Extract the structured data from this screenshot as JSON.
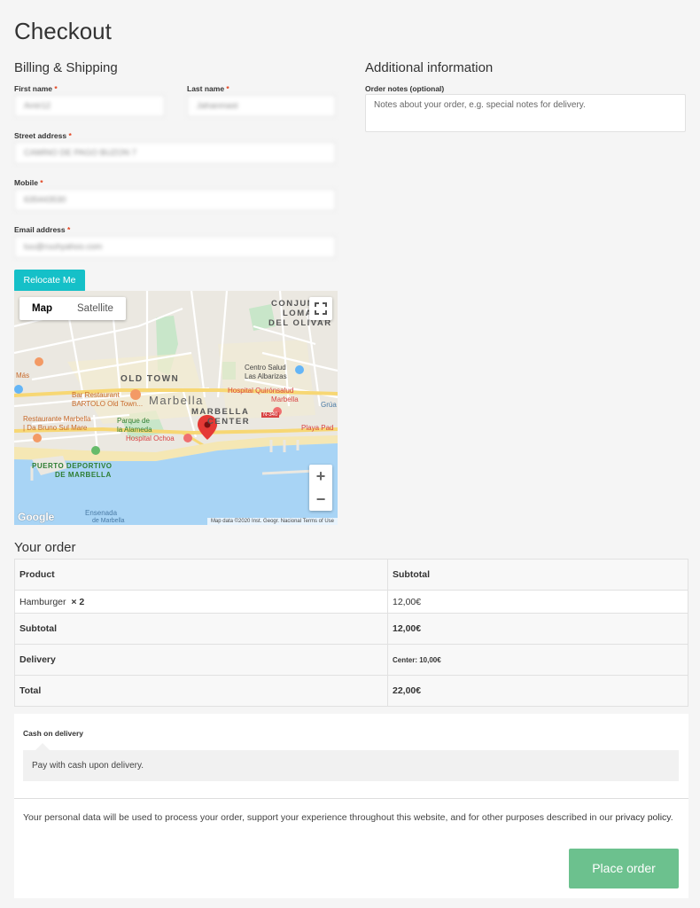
{
  "page": {
    "title": "Checkout"
  },
  "billing": {
    "section_title": "Billing & Shipping",
    "required_mark": "*",
    "first_name": {
      "label": "First name",
      "value": "Amir12"
    },
    "last_name": {
      "label": "Last name",
      "value": "Jahanmast"
    },
    "street": {
      "label": "Street address",
      "value": "CAMINO DE PAGO BUZON 7"
    },
    "mobile": {
      "label": "Mobile",
      "value": "635443530"
    },
    "email": {
      "label": "Email address",
      "value": "tuu@ruuhyahoo.com"
    },
    "relocate_label": "Relocate Me"
  },
  "additional": {
    "section_title": "Additional information",
    "notes_label": "Order notes (optional)",
    "notes_placeholder": "Notes about your order, e.g. special notes for delivery."
  },
  "map": {
    "tab_map": "Map",
    "tab_satellite": "Satellite",
    "zoom_in": "+",
    "zoom_out": "−",
    "google": "Google",
    "attribution": "Map data ©2020 Inst. Geogr. Nacional    Terms of Use",
    "labels": {
      "conjunto": "CONJUNTO",
      "lomas": "LOMAS",
      "del_olivar": "DEL OLIVAR",
      "old_town": "OLD TOWN",
      "marbella": "Marbella",
      "marbella_center_1": "MARBELLA",
      "marbella_center_2": "CENTER",
      "centro_salud": "Centro Salud",
      "las_albarizas": "Las Albarizas",
      "hospital_quiron": "Hospital Quirónsalud",
      "hospital_quiron_2": "Marbella",
      "bar_bartolo": "Bar Restaurant",
      "bar_bartolo_2": "BARTOLO Old Town...",
      "parque": "Parque de",
      "parque_2": "la Alameda",
      "restaurante": "Restaurante Marbella",
      "restaurante_2": "| Da Bruno Sul Mare",
      "hospital_ochoa": "Hospital Ochoa",
      "puerto": "PUERTO DEPORTIVO",
      "puerto_2": "DE MARBELLA",
      "ensenada": "Ensenada",
      "ensenada_2": "de Marbella",
      "playa": "Playa Pad",
      "n340": "N-340",
      "mas": "Más",
      "grua": "Grúa"
    }
  },
  "order": {
    "section_title": "Your order",
    "col_product": "Product",
    "col_subtotal": "Subtotal",
    "item_name": "Hamburger",
    "item_qty": "× 2",
    "item_subtotal": "12,00€",
    "subtotal_label": "Subtotal",
    "subtotal_value": "12,00€",
    "delivery_label": "Delivery",
    "delivery_value": "Center: 10,00€",
    "total_label": "Total",
    "total_value": "22,00€"
  },
  "payment": {
    "method": "Cash on delivery",
    "description": "Pay with cash upon delivery.",
    "privacy_text": "Your personal data will be used to process your order, support your experience throughout this website, and for other purposes described in our",
    "privacy_link": "privacy policy",
    "privacy_end": ".",
    "place_order": "Place order"
  },
  "colors": {
    "relocate_button": "#15c0c8",
    "place_order_button": "#6cc18e",
    "required": "#e2401c",
    "map_pin": "#e53935",
    "water": "#a8d4f5"
  }
}
